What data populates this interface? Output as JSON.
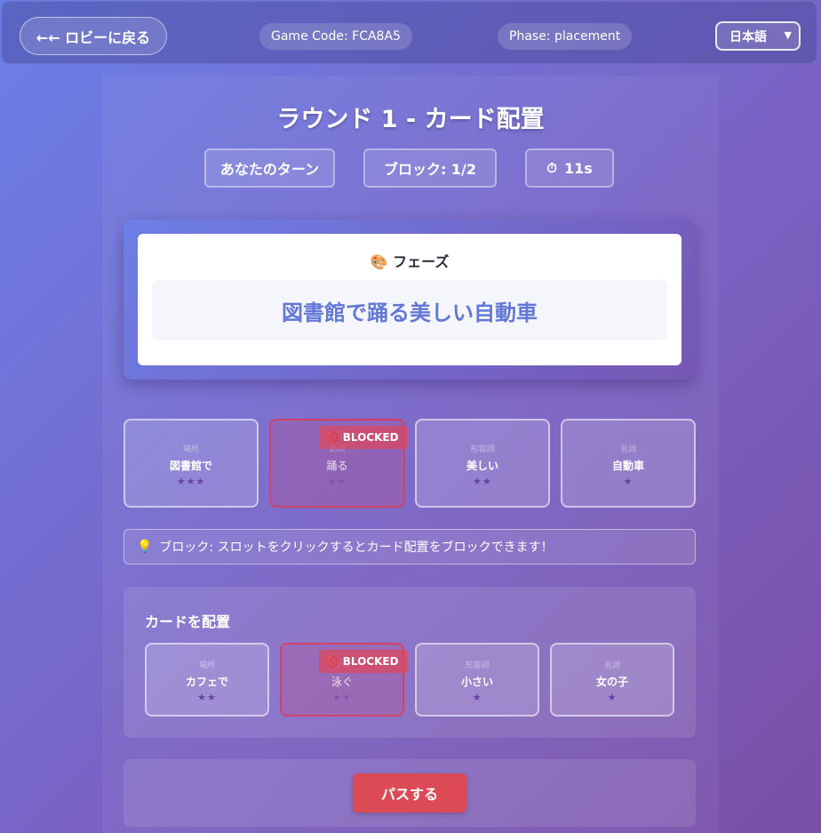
{
  "header": {
    "back_label": "←← ロビーに戻る",
    "game_code": "Game Code: FCA8A5",
    "phase": "Phase: placement",
    "language": "日本語"
  },
  "round": {
    "title": "ラウンド 1 - カード配置",
    "turn": "あなたのターン",
    "blocks": "ブロック: 1/2",
    "timer": "11s"
  },
  "phrase": {
    "heading": "🎨 フェーズ",
    "text": "図書館で踊る美しい自動車"
  },
  "slots": [
    {
      "category": "場所",
      "word": "図書館で",
      "stars": "★★★",
      "blocked": false
    },
    {
      "category": "動詞",
      "word": "踊る",
      "stars": "★★",
      "blocked": true
    },
    {
      "category": "形容詞",
      "word": "美しい",
      "stars": "★★",
      "blocked": false
    },
    {
      "category": "名詞",
      "word": "自動車",
      "stars": "★",
      "blocked": false
    }
  ],
  "blocked_label": "BLOCKED",
  "hint": "ブロック: スロットをクリックするとカード配置をブロックできます！",
  "hand": {
    "title": "カードを配置",
    "cards": [
      {
        "category": "場所",
        "word": "カフェで",
        "stars": "★★",
        "blocked": false
      },
      {
        "category": "動詞",
        "word": "泳ぐ",
        "stars": "★★",
        "blocked": true
      },
      {
        "category": "形容詞",
        "word": "小さい",
        "stars": "★",
        "blocked": false
      },
      {
        "category": "名詞",
        "word": "女の子",
        "stars": "★",
        "blocked": false
      }
    ]
  },
  "pass_label": "パスする",
  "colors": {
    "pass_button": "#dc4a55",
    "phrase_text": "#6277d6",
    "star": "#6a40a8",
    "blocked": "#e1465a"
  }
}
